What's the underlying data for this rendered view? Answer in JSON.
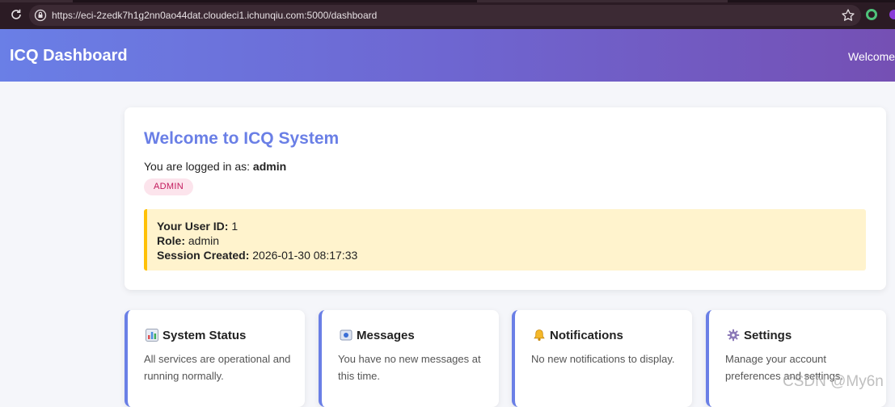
{
  "browser": {
    "url": "https://eci-2zedk7h1g2nn0ao44dat.cloudeci1.ichunqiu.com:5000/dashboard",
    "icons": [
      "reload-icon",
      "site-info-icon",
      "bookmark-star-icon",
      "extension-icon"
    ]
  },
  "header": {
    "brand": "ICQ Dashboard",
    "welcome": "Welcome,"
  },
  "welcome_card": {
    "title": "Welcome to ICQ System",
    "logged_in_prefix": "You are logged in as:",
    "username": "admin",
    "role_badge": "ADMIN",
    "info": {
      "user_id_label": "Your User ID:",
      "user_id": "1",
      "role_label": "Role:",
      "role": "admin",
      "session_label": "Session Created:",
      "session_created": "2026-01-30 08:17:33"
    }
  },
  "cards": [
    {
      "icon": "bar-chart-icon",
      "title": "System Status",
      "desc": "All services are operational and running normally."
    },
    {
      "icon": "message-icon",
      "title": "Messages",
      "desc": "You have no new messages at this time."
    },
    {
      "icon": "bell-icon",
      "title": "Notifications",
      "desc": "No new notifications to display."
    },
    {
      "icon": "gear-icon",
      "title": "Settings",
      "desc": "Manage your account preferences and settings."
    }
  ],
  "watermark": "CSDN @My6n",
  "colors": {
    "accent": "#6a7fe6",
    "header_gradient_end": "#7550b4",
    "badge_bg": "#fce4ec",
    "badge_text": "#c2185b",
    "info_bg": "#fff3cd",
    "info_border": "#ffc107"
  }
}
